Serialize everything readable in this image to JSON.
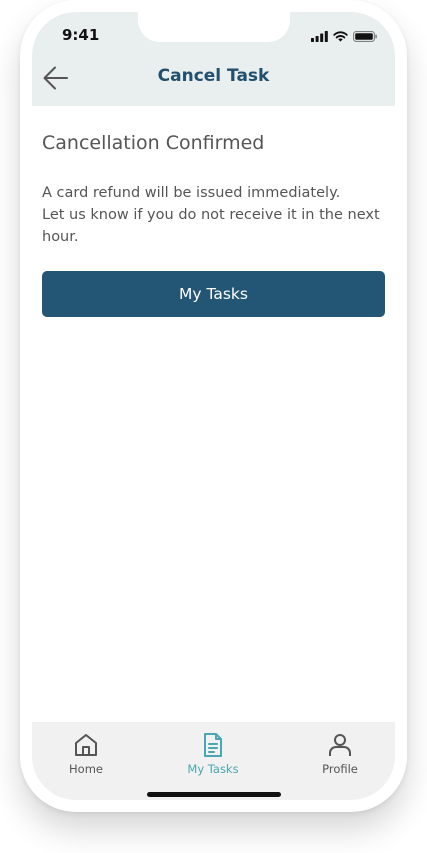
{
  "status_bar": {
    "time": "9:41"
  },
  "header": {
    "title": "Cancel Task",
    "back_icon": "arrow-left-icon"
  },
  "content": {
    "title": "Cancellation Confirmed",
    "body_lines": [
      "A card refund will be issued immediately.",
      "Let us know if you do not receive it in the next hour."
    ],
    "button_label": "My Tasks"
  },
  "tabbar": {
    "items": [
      {
        "label": "Home",
        "icon": "home-icon",
        "active": false
      },
      {
        "label": "My Tasks",
        "icon": "document-icon",
        "active": true
      },
      {
        "label": "Profile",
        "icon": "person-icon",
        "active": false
      }
    ]
  },
  "colors": {
    "header_bg": "#e9eeef",
    "title": "#234f6e",
    "primary": "#235675",
    "active_tab": "#4aa6b0",
    "text": "#555555"
  }
}
